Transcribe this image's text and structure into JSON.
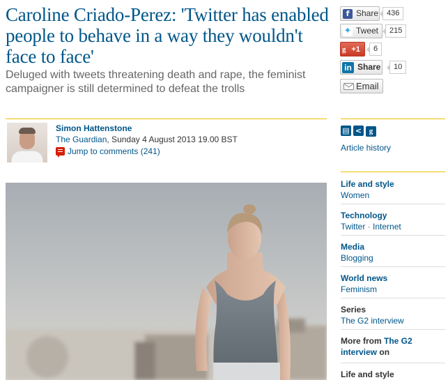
{
  "article": {
    "headline": "Caroline Criado-Perez: 'Twitter has enabled people to behave in a way they wouldn't face to face'",
    "standfirst": "Deluged with tweets threatening death and rape, the feminist campaigner is still determined to defeat the trolls"
  },
  "share": {
    "facebook": {
      "label": "Share",
      "count": "436",
      "icon": "facebook-icon"
    },
    "twitter": {
      "label": "Tweet",
      "count": "215",
      "icon": "twitter-bird-icon"
    },
    "gplus": {
      "label": "+1",
      "count": "6",
      "icon": "google-plus-icon"
    },
    "linkedin": {
      "label": "Share",
      "count": "10",
      "icon": "linkedin-icon"
    },
    "email": {
      "label": "Email",
      "icon": "envelope-icon"
    }
  },
  "byline": {
    "author": "Simon Hattenstone",
    "publication": "The Guardian",
    "date": ", Sunday 4 August 2013 19.00 BST",
    "comments": "Jump to comments (241)"
  },
  "tools": {
    "icons": [
      "print-icon",
      "share-icon",
      "google-icon"
    ],
    "article_history": "Article history"
  },
  "related": [
    {
      "heading": "Life and style",
      "links": [
        "Women"
      ]
    },
    {
      "heading": "Technology",
      "links": [
        "Twitter",
        "Internet"
      ]
    },
    {
      "heading": "Media",
      "links": [
        "Blogging"
      ]
    },
    {
      "heading": "World news",
      "links": [
        "Feminism"
      ]
    },
    {
      "heading": "Series",
      "links": [
        "The G2 interview"
      ]
    },
    {
      "heading_prefix": "More from ",
      "heading_link": "The G2 interview",
      "heading_suffix": " on"
    },
    {
      "heading": "Life and style"
    }
  ],
  "link_separator": " · ",
  "colors": {
    "link_blue": "#005689",
    "rule_yellow": "#ecc000",
    "standfirst_grey": "#666666"
  }
}
